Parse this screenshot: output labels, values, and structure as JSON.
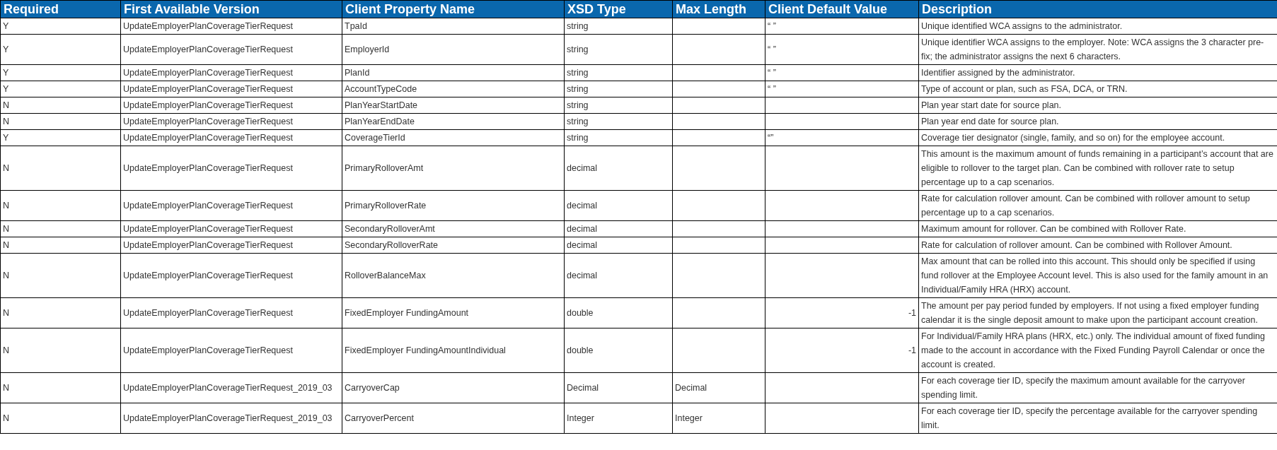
{
  "table": {
    "columns": [
      "Required",
      "First Available Version",
      "Client Property Name",
      "XSD Type",
      "Max Length",
      "Client Default Value",
      "Description"
    ],
    "rows": [
      [
        "Y",
        "UpdateEmployerPlanCoverageTierRequest",
        "TpaId",
        "string",
        "",
        "“ ”",
        "Unique identified WCA assigns to the administrator."
      ],
      [
        "Y",
        "UpdateEmployerPlanCoverageTierRequest",
        "EmployerId",
        "string",
        "",
        "“ ”",
        "Unique identifier WCA assigns to the employer. Note: WCA assigns the 3 character pre-fix; the administrator assigns the next 6 characters."
      ],
      [
        "Y",
        "UpdateEmployerPlanCoverageTierRequest",
        "PlanId",
        "string",
        "",
        "“ ”",
        "Identifier assigned by the administrator."
      ],
      [
        "Y",
        "UpdateEmployerPlanCoverageTierRequest",
        "AccountTypeCode",
        "string",
        "",
        "“ ”",
        "Type of account or plan, such as FSA, DCA, or TRN."
      ],
      [
        "N",
        "UpdateEmployerPlanCoverageTierRequest",
        "PlanYearStartDate",
        "string",
        "",
        "",
        "Plan year start date for source plan."
      ],
      [
        "N",
        "UpdateEmployerPlanCoverageTierRequest",
        "PlanYearEndDate",
        "string",
        "",
        "",
        "Plan year end date for source plan."
      ],
      [
        "Y",
        "UpdateEmployerPlanCoverageTierRequest",
        "CoverageTierId",
        "string",
        "",
        "“”",
        "Coverage tier designator (single, family, and so on) for the employee account."
      ],
      [
        "N",
        "UpdateEmployerPlanCoverageTierRequest",
        "PrimaryRolloverAmt",
        "decimal",
        "",
        "",
        "This amount is the maximum amount of funds remaining in a participant’s account that are eligible to rollover to the target plan.  Can be combined with rollover rate to setup percentage up to a cap scenarios."
      ],
      [
        "N",
        "UpdateEmployerPlanCoverageTierRequest",
        "PrimaryRolloverRate",
        "decimal",
        "",
        "",
        "Rate for calculation rollover amount. Can be combined with rollover amount to setup percentage up to a cap scenarios."
      ],
      [
        "N",
        "UpdateEmployerPlanCoverageTierRequest",
        "SecondaryRolloverAmt",
        "decimal",
        "",
        "",
        "Maximum amount for rollover. Can be combined with Rollover Rate."
      ],
      [
        "N",
        "UpdateEmployerPlanCoverageTierRequest",
        "SecondaryRolloverRate",
        "decimal",
        "",
        "",
        "Rate for calculation of rollover amount. Can be combined with Rollover Amount."
      ],
      [
        "N",
        "UpdateEmployerPlanCoverageTierRequest",
        "RolloverBalanceMax",
        "decimal",
        "",
        "",
        "Max amount that can be rolled into this account. This should only be specified if using fund rollover at the Employee Account level. This is also used for the family amount in an Individual/Family HRA (HRX) account."
      ],
      [
        "N",
        "UpdateEmployerPlanCoverageTierRequest",
        "FixedEmployer FundingAmount",
        "double",
        "",
        "-1",
        "The amount per pay period funded by employers. If not using a fixed employer funding calendar it is the single deposit amount to make upon the participant account creation."
      ],
      [
        "N",
        "UpdateEmployerPlanCoverageTierRequest",
        "FixedEmployer FundingAmountIndividual",
        "double",
        "",
        "-1",
        "For Individual/Family HRA plans (HRX, etc.) only. The individual amount of fixed funding made to the account in accordance with the Fixed Funding Payroll Calendar or once the account is created."
      ],
      [
        "N",
        "UpdateEmployerPlanCoverageTierRequest_2019_03",
        "CarryoverCap",
        "Decimal",
        "Decimal",
        "",
        "For each coverage tier ID, specify the maximum amount available for the carryover spending limit."
      ],
      [
        "N",
        "UpdateEmployerPlanCoverageTierRequest_2019_03",
        "CarryoverPercent",
        "Integer",
        "Integer",
        "",
        "For each coverage tier ID, specify the percentage available for the carryover spending limit."
      ]
    ]
  }
}
